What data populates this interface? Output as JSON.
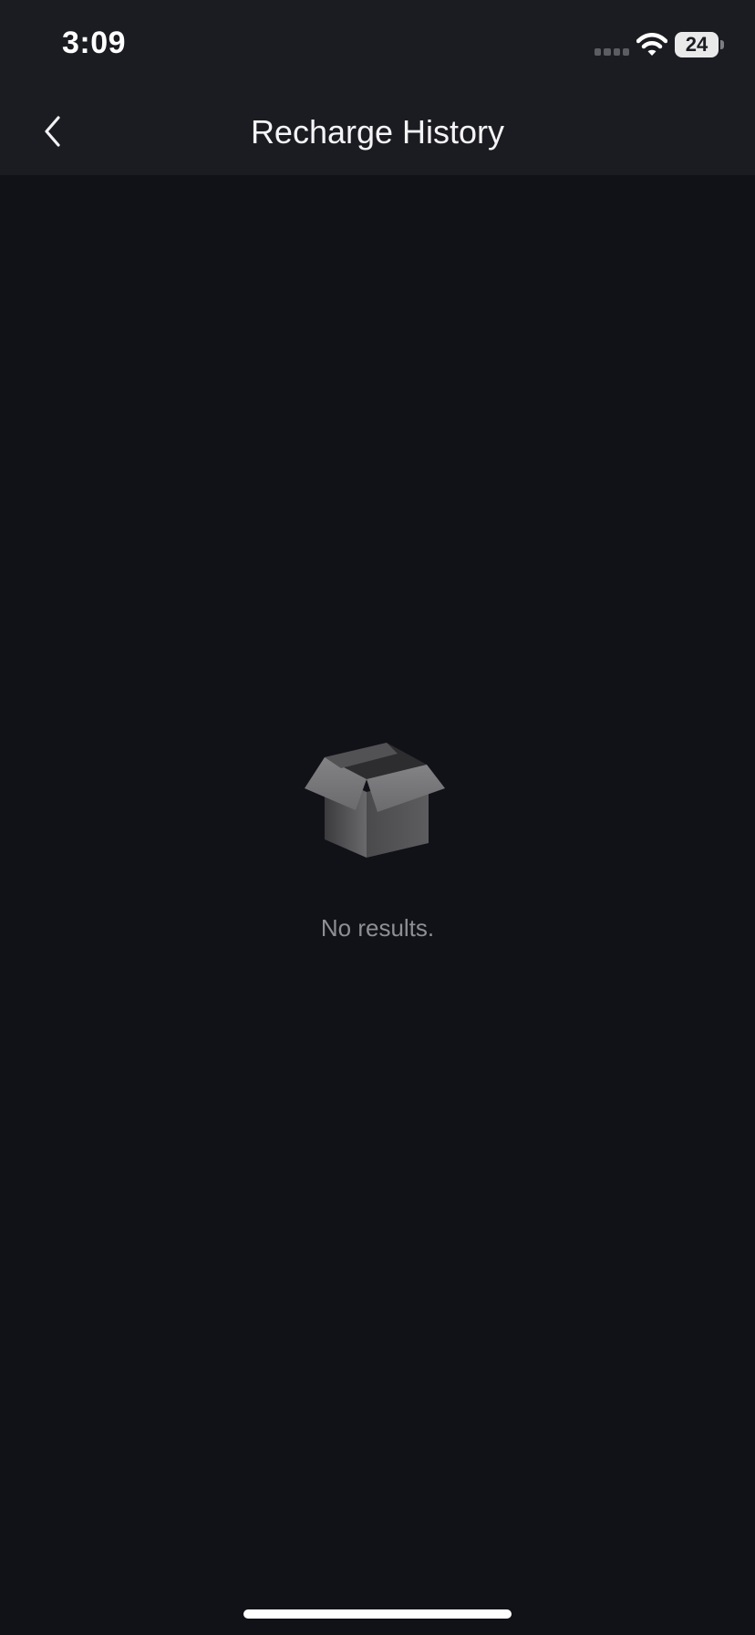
{
  "status_bar": {
    "time": "3:09",
    "battery_level": "24"
  },
  "nav": {
    "title": "Recharge History",
    "back_icon": "chevron-left-icon"
  },
  "empty_state": {
    "icon": "open-box-icon",
    "message": "No results."
  },
  "colors": {
    "background": "#111218",
    "header": "#1b1c21",
    "title_text": "#f4f4f6",
    "muted_text": "#8e8f94"
  }
}
